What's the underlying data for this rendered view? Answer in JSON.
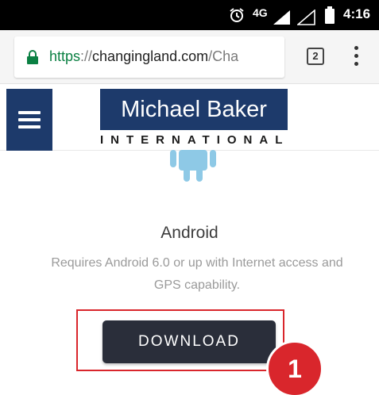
{
  "status_bar": {
    "network": "4G",
    "time": "4:16",
    "icons": [
      "alarm-icon",
      "signal-icon",
      "signal-empty-icon",
      "battery-icon"
    ]
  },
  "browser": {
    "url_scheme": "https",
    "url_separator": "://",
    "url_host": "changingland.com",
    "url_rest": "/Cha",
    "tab_count": "2",
    "icons": [
      "lock-icon",
      "tabs-icon",
      "overflow-menu-icon"
    ]
  },
  "site": {
    "logo_main": "Michael Baker",
    "logo_sub": "INTERNATIONAL",
    "menu_icon": "hamburger-menu-icon"
  },
  "content": {
    "platform_icon": "android-icon",
    "heading": "Android",
    "description": "Requires Android 6.0 or up with Internet access and GPS capability.",
    "download_label": "DOWNLOAD",
    "step_number": "1"
  },
  "colors": {
    "brand_navy": "#1d3a6b",
    "button_dark": "#2a2e3a",
    "annotation_red": "#d9262c",
    "android_blue": "#8ec9e6",
    "secure_green": "#0b8043"
  }
}
